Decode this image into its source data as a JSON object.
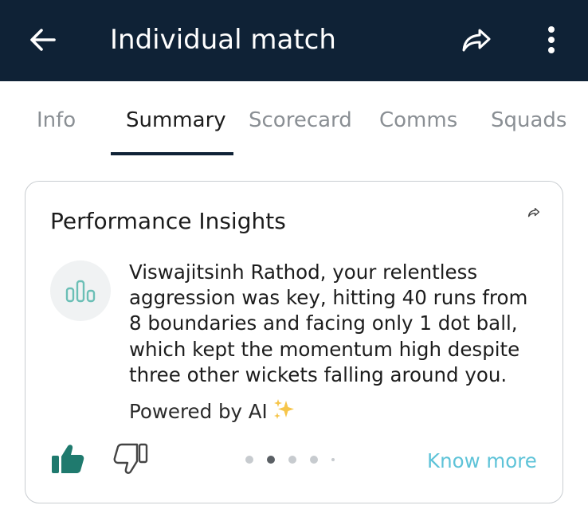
{
  "app_bar": {
    "title": "Individual match",
    "background": "#0f2236",
    "icons": [
      "arrow-left-icon",
      "share-icon",
      "more-vertical-icon"
    ]
  },
  "tabs": [
    {
      "label": "Info",
      "active": false
    },
    {
      "label": "Summary",
      "active": true
    },
    {
      "label": "Scorecard",
      "active": false
    },
    {
      "label": "Comms",
      "active": false
    },
    {
      "label": "Squads",
      "active": false
    }
  ],
  "insights_card": {
    "title": "Performance Insights",
    "player_name": "Viswajitsinh Rathod",
    "insight_text": ", your relentless aggression was key, hitting 40 runs from 8 boundaries and facing only 1 dot ball, which kept the momentum high despite three other wickets falling around you.",
    "powered_by": "Powered by AI",
    "know_more_label": "Know more",
    "carousel": {
      "total": 5,
      "active_index": 1
    },
    "colors": {
      "like": "#1f7a6e",
      "know_more": "#5ec3d8",
      "icon": "#6bbfb6"
    }
  }
}
